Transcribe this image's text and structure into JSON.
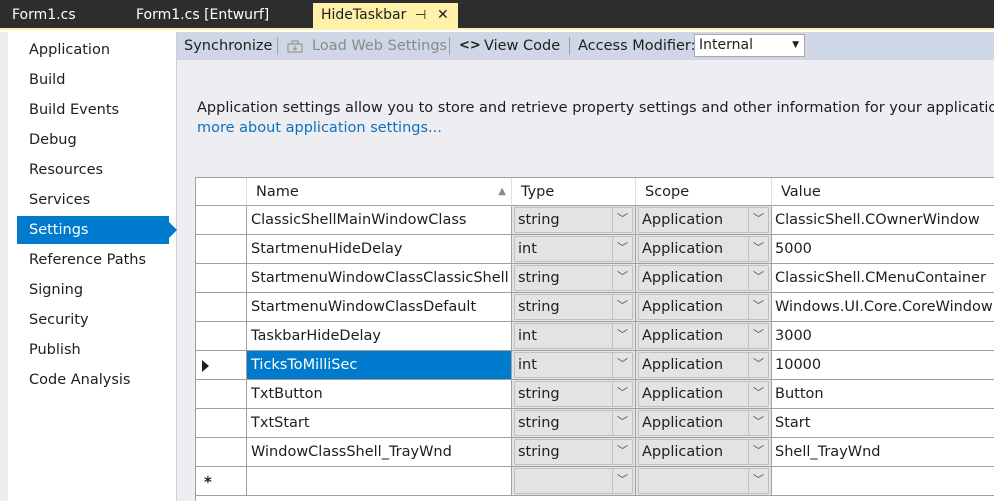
{
  "tabs": [
    {
      "label": "Form1.cs"
    },
    {
      "label": "Form1.cs [Entwurf]"
    },
    {
      "label": "HideTaskbar",
      "pin": "⊣",
      "close": "✕"
    }
  ],
  "nav": {
    "items": [
      {
        "label": "Application"
      },
      {
        "label": "Build"
      },
      {
        "label": "Build Events"
      },
      {
        "label": "Debug"
      },
      {
        "label": "Resources"
      },
      {
        "label": "Services"
      },
      {
        "label": "Settings"
      },
      {
        "label": "Reference Paths"
      },
      {
        "label": "Signing"
      },
      {
        "label": "Security"
      },
      {
        "label": "Publish"
      },
      {
        "label": "Code Analysis"
      }
    ],
    "selected": "Settings"
  },
  "toolbar": {
    "synchronize": "Synchronize",
    "load_web_settings": "Load Web Settings",
    "view_code_icon": "<>",
    "view_code": "View Code",
    "access_modifier_label": "Access Modifier:",
    "access_modifier_value": "Internal"
  },
  "description": {
    "line1": "Application settings allow you to store and retrieve property settings and other information for your application dynam",
    "link": "more about application settings..."
  },
  "grid": {
    "headers": {
      "name": "Name",
      "type": "Type",
      "scope": "Scope",
      "value": "Value"
    },
    "rows": [
      {
        "name": "ClassicShellMainWindowClass",
        "type": "string",
        "scope": "Application",
        "value": "ClassicShell.COwnerWindow"
      },
      {
        "name": "StartmenuHideDelay",
        "type": "int",
        "scope": "Application",
        "value": "5000"
      },
      {
        "name": "StartmenuWindowClassClassicShell",
        "type": "string",
        "scope": "Application",
        "value": "ClassicShell.CMenuContainer"
      },
      {
        "name": "StartmenuWindowClassDefault",
        "type": "string",
        "scope": "Application",
        "value": "Windows.UI.Core.CoreWindow"
      },
      {
        "name": "TaskbarHideDelay",
        "type": "int",
        "scope": "Application",
        "value": "3000"
      },
      {
        "name": "TicksToMilliSec",
        "type": "int",
        "scope": "Application",
        "value": "10000"
      },
      {
        "name": "TxtButton",
        "type": "string",
        "scope": "Application",
        "value": "Button"
      },
      {
        "name": "TxtStart",
        "type": "string",
        "scope": "Application",
        "value": "Start"
      },
      {
        "name": "WindowClassShell_TrayWnd",
        "type": "string",
        "scope": "Application",
        "value": "Shell_TrayWnd"
      }
    ],
    "selected_row": "TicksToMilliSec",
    "new_row_marker": "*",
    "dropdown_glyph": "﹀"
  },
  "colors": {
    "accent": "#007acc",
    "tab_active": "#fff1a8",
    "tab_strip": "#2d2d30",
    "toolbar": "#cfd6e5",
    "content_bg": "#eeeef2",
    "link": "#0e70c0"
  }
}
